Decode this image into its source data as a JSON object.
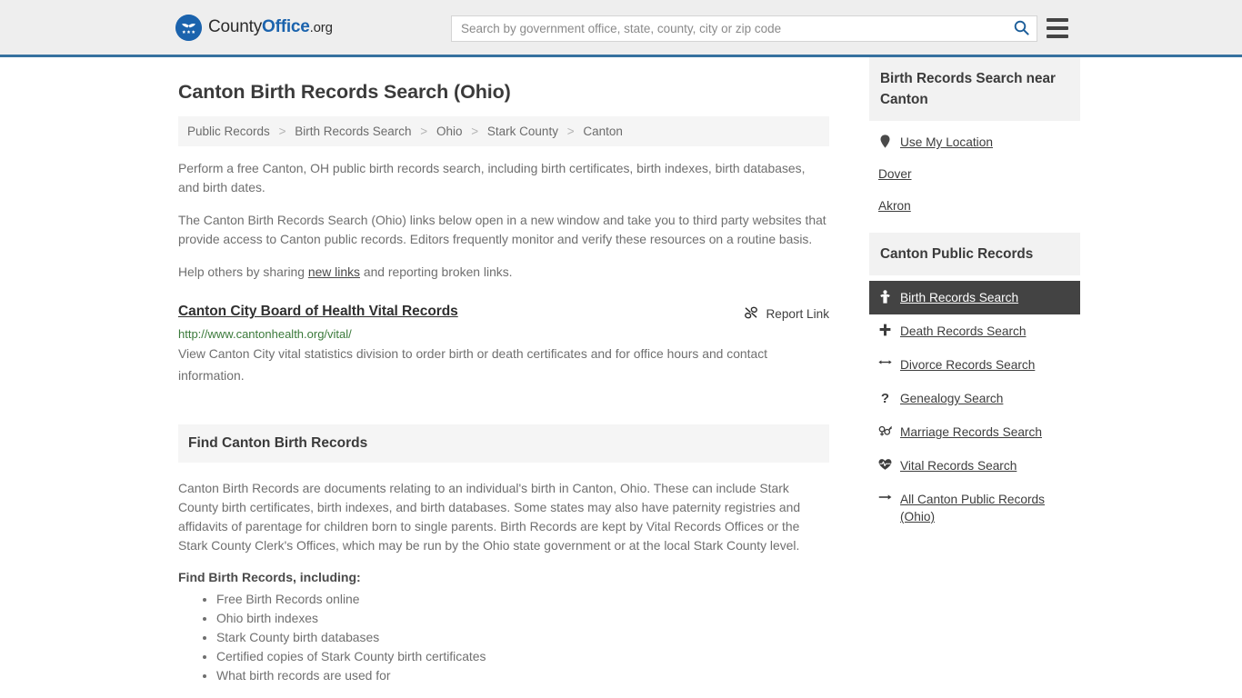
{
  "header": {
    "logo": {
      "part1": "County",
      "part2": "Office",
      "part3": ".org",
      "icon": "eagle-seal-icon"
    },
    "search": {
      "placeholder": "Search by government office, state, county, city or zip code",
      "value": "",
      "button_icon": "search-icon"
    },
    "menu_icon": "hamburger-menu-icon"
  },
  "page": {
    "title": "Canton Birth Records Search (Ohio)"
  },
  "breadcrumb": {
    "separator": ">",
    "items": [
      {
        "label": "Public Records",
        "current": false
      },
      {
        "label": "Birth Records Search",
        "current": false
      },
      {
        "label": "Ohio",
        "current": false
      },
      {
        "label": "Stark County",
        "current": false
      },
      {
        "label": "Canton",
        "current": true
      }
    ]
  },
  "intro": {
    "p1": "Perform a free Canton, OH public birth records search, including birth certificates, birth indexes, birth databases, and birth dates.",
    "p2": "The Canton Birth Records Search (Ohio) links below open in a new window and take you to third party websites that provide access to Canton public records. Editors frequently monitor and verify these resources on a routine basis.",
    "p3_before": "Help others by sharing ",
    "p3_link": "new links",
    "p3_after": " and reporting broken links."
  },
  "result": {
    "title": "Canton City Board of Health Vital Records",
    "report_label": "Report Link",
    "report_icon": "broken-link-icon",
    "url": "http://www.cantonhealth.org/vital/",
    "description": "View Canton City vital statistics division to order birth or death certificates and for office hours and contact information."
  },
  "find_section": {
    "heading": "Find Canton Birth Records",
    "paragraph": "Canton Birth Records are documents relating to an individual's birth in Canton, Ohio. These can include Stark County birth certificates, birth indexes, and birth databases. Some states may also have paternity registries and affidavits of parentage for children born to single parents. Birth Records are kept by Vital Records Offices or the Stark County Clerk's Offices, which may be run by the Ohio state government or at the local Stark County level.",
    "subheading": "Find Birth Records, including:",
    "bullets": [
      "Free Birth Records online",
      "Ohio birth indexes",
      "Stark County birth databases",
      "Certified copies of Stark County birth certificates",
      "What birth records are used for"
    ]
  },
  "sidebar": {
    "near_box": {
      "title": "Birth Records Search near Canton",
      "links": [
        {
          "label": "Use My Location",
          "icon": "map-pin-icon"
        },
        {
          "label": "Dover",
          "icon": ""
        },
        {
          "label": "Akron",
          "icon": ""
        }
      ]
    },
    "records_box": {
      "title": "Canton Public Records",
      "links": [
        {
          "label": "Birth Records Search",
          "icon": "baby-icon",
          "active": true
        },
        {
          "label": "Death Records Search",
          "icon": "cross-icon",
          "active": false
        },
        {
          "label": "Divorce Records Search",
          "icon": "arrows-left-right-icon",
          "active": false
        },
        {
          "label": "Genealogy Search",
          "icon": "question-mark-icon",
          "active": false
        },
        {
          "label": "Marriage Records Search",
          "icon": "venus-mars-icon",
          "active": false
        },
        {
          "label": "Vital Records Search",
          "icon": "heart-pulse-icon",
          "active": false
        },
        {
          "label": "All Canton Public Records (Ohio)",
          "icon": "arrow-right-icon",
          "active": false
        }
      ]
    }
  },
  "colors": {
    "brand_blue": "#1b63ad",
    "header_bg": "#eeeeee",
    "header_rule": "#36719f",
    "panel_gray": "#f2f2f2",
    "active_dark": "#434343",
    "url_green": "#3b7a3b",
    "body_text": "#6f6f6f"
  }
}
